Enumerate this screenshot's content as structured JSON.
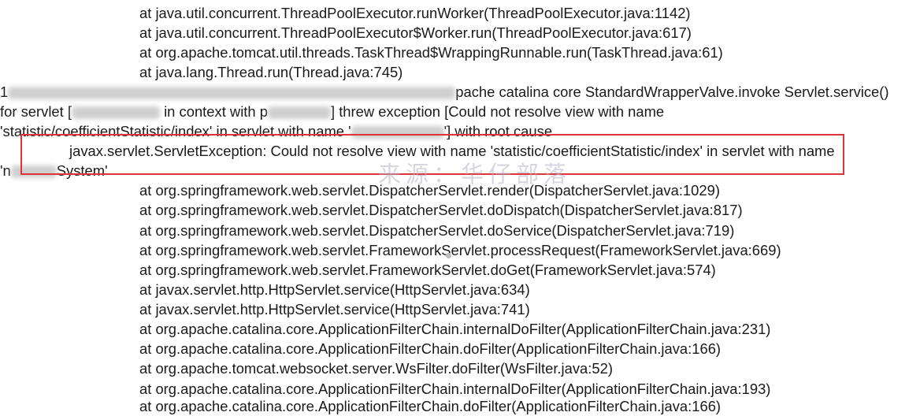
{
  "trace_top": [
    "at java.util.concurrent.ThreadPoolExecutor.runWorker(ThreadPoolExecutor.java:1142)",
    "at java.util.concurrent.ThreadPoolExecutor$Worker.run(ThreadPoolExecutor.java:617)",
    "at org.apache.tomcat.util.threads.TaskThread$WrappingRunnable.run(TaskThread.java:61)",
    "at java.lang.Thread.run(Thread.java:745)"
  ],
  "log_message": {
    "line1_prefix": "1",
    "line1_tail": "pache catalina core StandardWrapperValve.invoke Servlet.service()",
    "line2_prefix": "for servlet [",
    "line2_mid": "in context with p",
    "line2_tail": "] threw exception [Could not resolve view with name",
    "line3_head": "'statistic/coefficientStatistic/index' in servlet with name '",
    "line3_tail": "'] with root cause"
  },
  "exception": {
    "line": "javax.servlet.ServletException: Could not resolve view with name 'statistic/coefficientStatistic/index' in servlet with name",
    "continuation_head": "'n",
    "continuation_tail": "System'"
  },
  "watermark_text": "来源：华仔部落",
  "trace_bottom": [
    "at org.springframework.web.servlet.DispatcherServlet.render(DispatcherServlet.java:1029)",
    "at org.springframework.web.servlet.DispatcherServlet.doDispatch(DispatcherServlet.java:817)",
    "at org.springframework.web.servlet.DispatcherServlet.doService(DispatcherServlet.java:719)",
    "at org.springframework.web.servlet.FrameworkServlet.processRequest(FrameworkServlet.java:669)",
    "at org.springframework.web.servlet.FrameworkServlet.doGet(FrameworkServlet.java:574)",
    "at javax.servlet.http.HttpServlet.service(HttpServlet.java:634)",
    "at javax.servlet.http.HttpServlet.service(HttpServlet.java:741)",
    "at org.apache.catalina.core.ApplicationFilterChain.internalDoFilter(ApplicationFilterChain.java:231)",
    "at org.apache.catalina.core.ApplicationFilterChain.doFilter(ApplicationFilterChain.java:166)",
    "at org.apache.tomcat.websocket.server.WsFilter.doFilter(WsFilter.java:52)",
    "at org.apache.catalina.core.ApplicationFilterChain.internalDoFilter(ApplicationFilterChain.java:193)",
    "at org.apache.catalina.core.ApplicationFilterChain.doFilter(ApplicationFilterChain.java:166)"
  ],
  "colors": {
    "highlight_border": "#e0323b",
    "text": "#1a1a1a",
    "watermark": "#b5b5c9"
  }
}
